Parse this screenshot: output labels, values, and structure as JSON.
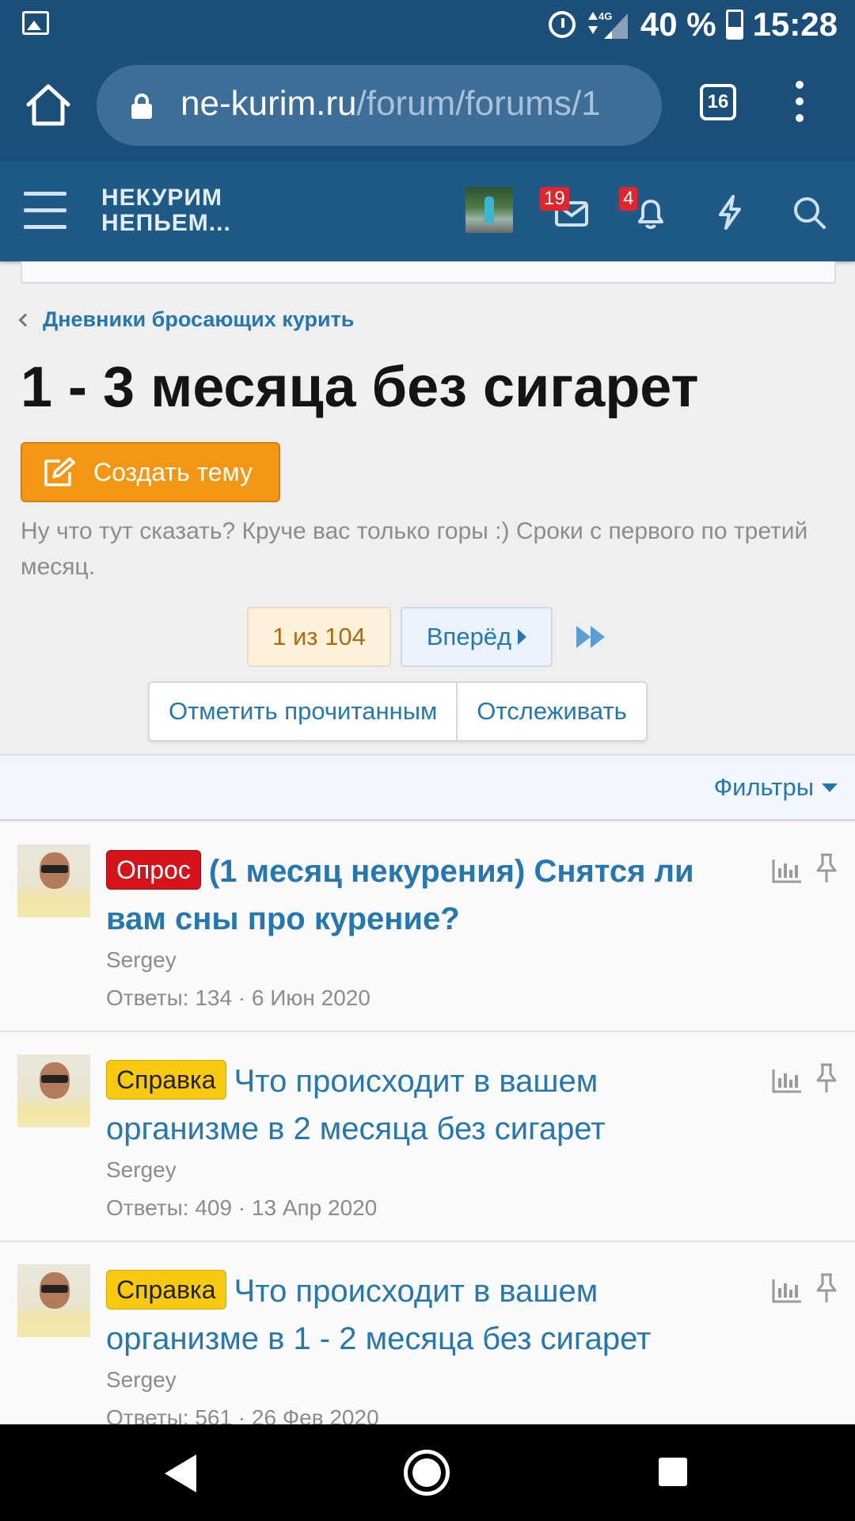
{
  "status_bar": {
    "network": "4G",
    "battery": "40 %",
    "time": "15:28"
  },
  "browser": {
    "url_domain": "ne-kurim.ru",
    "url_path": "/forum/forums/1",
    "tab_count": "16"
  },
  "site_header": {
    "logo_line1": "НЕКУРИМ",
    "logo_line2": "НЕПЬЕМ...",
    "messages_badge": "19",
    "alerts_badge": "4"
  },
  "page": {
    "breadcrumb": "Дневники бросающих курить",
    "title": "1 - 3 месяца без сигарет",
    "create_button": "Создать тему",
    "description": "Ну что тут сказать? Круче вас только горы :) Сроки с первого по третий месяц.",
    "pager_current": "1 из 104",
    "pager_next": "Вперёд",
    "mark_read": "Отметить прочитанным",
    "watch": "Отслеживать",
    "filters": "Фильтры"
  },
  "threads": [
    {
      "label": "Опрос",
      "title": "(1 месяц некурения) Снятся ли вам сны про курение?",
      "author": "Sergey",
      "meta": "Ответы: 134 · 6 Июн 2020"
    },
    {
      "label": "Справка",
      "title": "Что происходит в вашем организме в 2 месяца без сигарет",
      "author": "Sergey",
      "meta": "Ответы: 409 · 13 Апр 2020"
    },
    {
      "label": "Справка",
      "title": "Что происходит в вашем организме в 1 - 2 месяца без сигарет",
      "author": "Sergey",
      "meta": "Ответы: 561 · 26 Фев 2020"
    }
  ],
  "colors": {
    "header_bg": "#1f5a86",
    "browser_bg": "#1b4f7a",
    "link": "#2577b1",
    "create_button": "#f39614",
    "label_poll": "#d6131a",
    "label_help": "#f7c90f"
  },
  "icons": [
    "image-icon",
    "alarm-icon",
    "signal-icon",
    "battery-icon",
    "home-icon",
    "lock-icon",
    "tabs-icon",
    "overflow-menu-icon",
    "hamburger-icon",
    "mail-icon",
    "bell-icon",
    "lightning-icon",
    "search-icon",
    "chevron-left-icon",
    "edit-icon",
    "play-icon",
    "fast-forward-icon",
    "caret-down-icon",
    "stats-icon",
    "pin-icon",
    "back-icon",
    "home-circle-icon",
    "recents-icon"
  ]
}
